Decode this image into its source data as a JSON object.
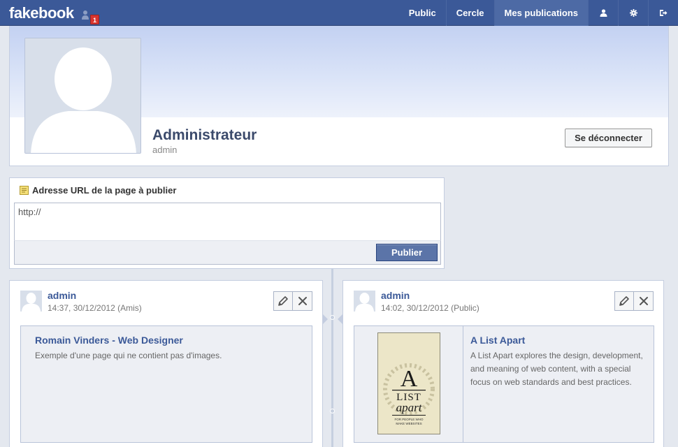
{
  "header": {
    "logo": "fakebook",
    "notification_count": "1",
    "nav": [
      {
        "label": "Public"
      },
      {
        "label": "Cercle"
      },
      {
        "label": "Mes publications",
        "active": true
      }
    ],
    "icons": [
      "user-icon",
      "gear-icon",
      "logout-icon"
    ],
    "colors": {
      "bar": "#3b5998",
      "active": "#4d6aa5",
      "badge": "#d9342f"
    }
  },
  "profile": {
    "name": "Administrateur",
    "login": "admin",
    "logout_label": "Se déconnecter"
  },
  "publish": {
    "title": "Adresse URL de la page à publier",
    "input_value": "http://",
    "button_label": "Publier"
  },
  "posts": [
    {
      "author": "admin",
      "meta": "14:37, 30/12/2012 (Amis)",
      "link_title": "Romain Vinders - Web Designer",
      "link_desc": "Exemple d'une page qui ne contient pas d'images."
    },
    {
      "author": "admin",
      "meta": "14:02, 30/12/2012 (Public)",
      "link_title": "A List Apart",
      "link_desc": "A List Apart explores the design, development, and meaning of web content, with a special focus on web standards and best practices.",
      "thumb": {
        "big": "A",
        "line1": "LIST",
        "line2": "apart",
        "tag1": "FOR PEOPLE WHO",
        "tag2": "MAKE WEBSITES"
      }
    }
  ]
}
